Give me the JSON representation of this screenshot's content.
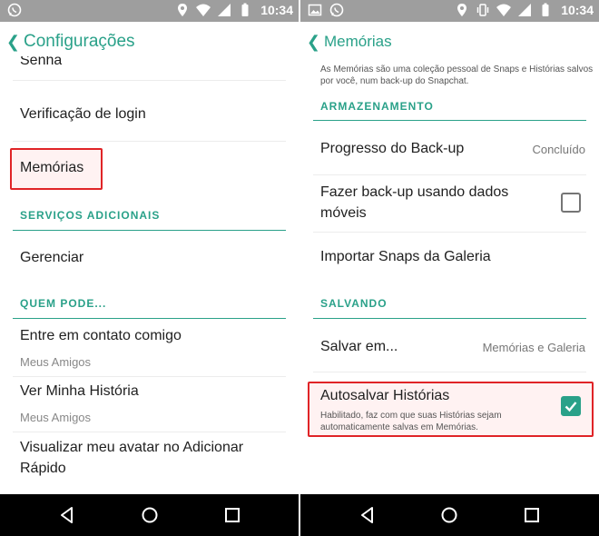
{
  "statusbar": {
    "time": "10:34"
  },
  "left": {
    "title": "Configurações",
    "partial_item": "Senha",
    "items": {
      "verificacao": "Verificação de login",
      "memorias": "Memórias"
    },
    "section_servicos": "SERVIÇOS ADICIONAIS",
    "gerenciar": "Gerenciar",
    "section_quem": "QUEM PODE...",
    "contato": {
      "label": "Entre em contato comigo",
      "value": "Meus Amigos"
    },
    "historia": {
      "label": "Ver Minha História",
      "value": "Meus Amigos"
    },
    "avatar": {
      "line1": "Visualizar meu avatar no Adicionar",
      "line2": "Rápido"
    }
  },
  "right": {
    "title": "Memórias",
    "description": {
      "line1": "As Memórias são uma coleção pessoal de Snaps e Histórias salvos",
      "line2": "por você, num back-up do Snapchat."
    },
    "section_armazenamento": "ARMAZENAMENTO",
    "progresso": {
      "label": "Progresso do Back-up",
      "value": "Concluído"
    },
    "backup_dados": {
      "line1": "Fazer back-up usando dados",
      "line2": "móveis",
      "checked": false
    },
    "importar": "Importar Snaps da Galeria",
    "section_salvando": "SALVANDO",
    "salvar_em": {
      "label": "Salvar em...",
      "value": "Memórias e Galeria"
    },
    "autosalvar": {
      "label": "Autosalvar Histórias",
      "desc_line1": "Habilitado, faz com que suas Histórias sejam",
      "desc_line2": "automaticamente salvas em Memórias.",
      "checked": true
    }
  },
  "colors": {
    "accent": "#2aa189",
    "highlight": "#e02427",
    "statusbar": "#9e9e9e",
    "navbar": "#000000"
  },
  "icons": [
    "whatsapp-icon",
    "location-icon",
    "wifi-icon",
    "signal-icon",
    "battery-icon",
    "image-icon",
    "vibrate-icon",
    "back-nav-icon",
    "home-nav-icon",
    "recents-nav-icon",
    "chevron-left-icon",
    "check-icon"
  ]
}
